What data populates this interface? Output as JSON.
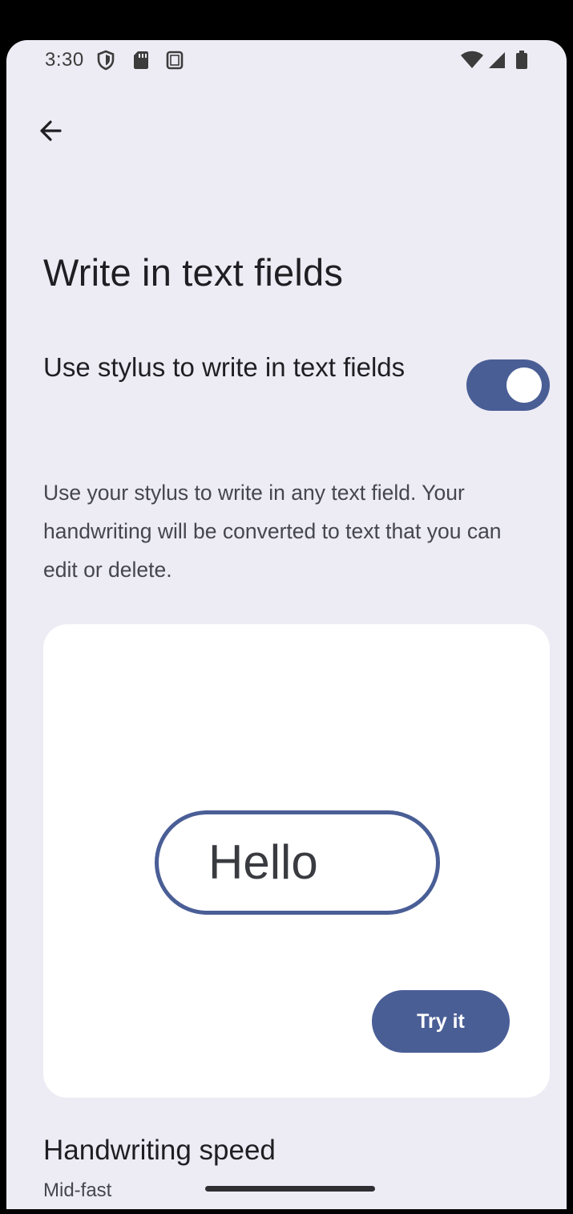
{
  "status_bar": {
    "time": "3:30",
    "icons_left": [
      "shield-icon",
      "sd-card-icon",
      "screenshot-icon"
    ],
    "icons_right": [
      "wifi-icon",
      "signal-icon",
      "battery-icon"
    ]
  },
  "app_bar": {
    "back_icon": "arrow-back-icon"
  },
  "page": {
    "title": "Write in text fields"
  },
  "toggle": {
    "label": "Use stylus to write in text fields",
    "checked": true
  },
  "description": "Use your stylus to write in any text field. Your handwriting will be converted to text that you can edit or delete.",
  "demo": {
    "field_text": "Hello",
    "try_button_label": "Try it"
  },
  "speed": {
    "title": "Handwriting speed",
    "value": "Mid-fast"
  },
  "colors": {
    "background": "#edecf4",
    "accent": "#4a5e96",
    "card": "#ffffff"
  }
}
